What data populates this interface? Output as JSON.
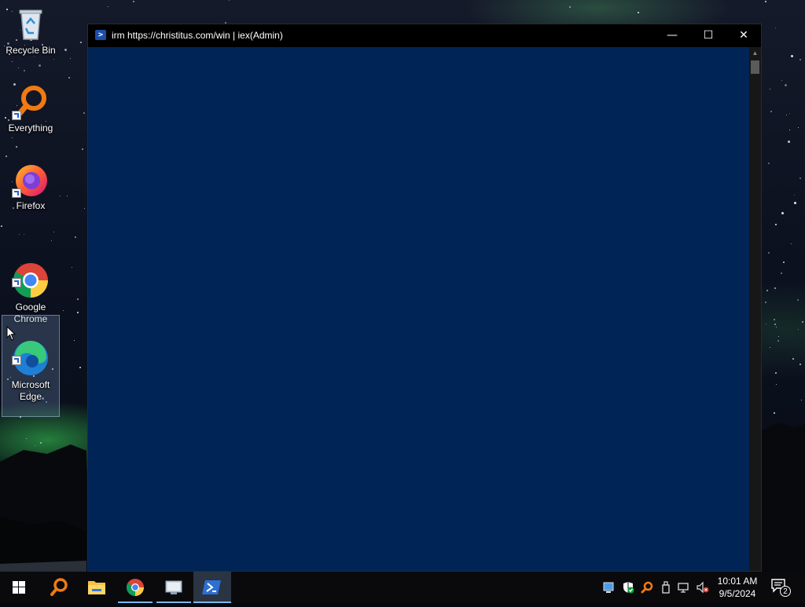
{
  "desktop": {
    "icons": [
      {
        "label": "Recycle Bin",
        "icon": "recycle-bin-icon"
      },
      {
        "label": "Everything",
        "icon": "everything-search-icon"
      },
      {
        "label": "Firefox",
        "icon": "firefox-icon"
      },
      {
        "label": "Google\nChrome",
        "icon": "chrome-icon"
      },
      {
        "label": "Microsoft\nEdge",
        "icon": "edge-icon"
      }
    ]
  },
  "window": {
    "title": "irm https://christitus.com/win | iex(Admin)",
    "minimize_glyph": "—",
    "maximize_glyph": "☐",
    "close_glyph": "✕",
    "console_background": "#012456"
  },
  "taskbar": {
    "pinned": [
      "start-icon",
      "everything-icon",
      "file-explorer-icon",
      "chrome-icon",
      "remote-desktop-icon",
      "powershell-icon"
    ],
    "tray": [
      "display-icon",
      "defender-icon",
      "everything-tray-icon",
      "usb-icon",
      "network-icon",
      "volume-muted-icon"
    ],
    "clock_time": "10:01 AM",
    "clock_date": "9/5/2024",
    "notification_count": "2"
  },
  "colors": {
    "taskbar": "#0a0a0d",
    "accent": "#76b9ed",
    "powershell_blue": "#012456"
  }
}
